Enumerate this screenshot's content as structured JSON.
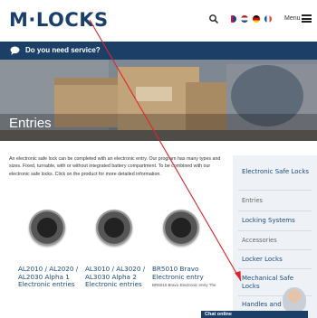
{
  "header": {
    "logo": "M·LOCKS",
    "menu_label": "Menu"
  },
  "service_bar": {
    "text": "Do you need service?"
  },
  "hero": {
    "title": "Entries"
  },
  "intro": {
    "text": "An electronic safe lock can be completed with an electronic entry. Our program has many types and sizes. Fixed, turnable, with or without integrated battery compartment. To be combined with our electronic safe locks. Click on the product for more detailed information."
  },
  "products": [
    {
      "name": "AL2010 / AL2020 / AL2030 Alpha 1 Electronic entries",
      "desc": ""
    },
    {
      "name": "AL3010 / AL3020 / AL3030 Alpha 2 Electronic entries",
      "desc": ""
    },
    {
      "name": "BR5010 Bravo Electronic entry",
      "desc": "BR5010 Bravo Electronic entry The"
    }
  ],
  "sidebar": {
    "items": [
      {
        "label": "Electronic Safe Locks"
      },
      {
        "label": "Entries"
      },
      {
        "label": "Locking Systems"
      },
      {
        "label": "Accessories"
      },
      {
        "label": "Locker Locks"
      },
      {
        "label": "Mechanical Safe Locks"
      },
      {
        "label": "Handles and Dials"
      }
    ]
  },
  "chat": {
    "label": "Chat online"
  },
  "colors": {
    "brand_navy": "#1c3f67",
    "link_blue": "#1c4a7d",
    "sidebar_bg": "#eef1f5",
    "annotation_red": "#e0242b"
  }
}
